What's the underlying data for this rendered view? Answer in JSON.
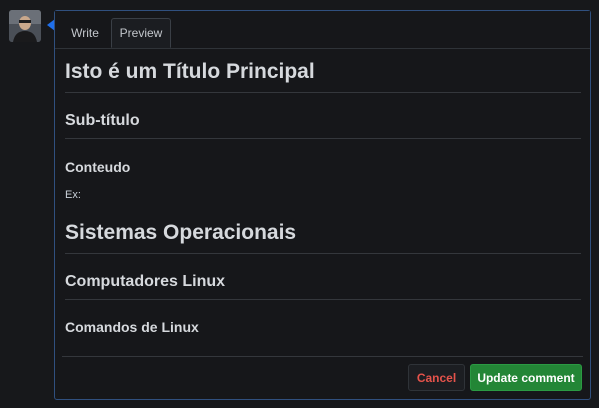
{
  "comment_editor": {
    "tabs": [
      {
        "label": "Write",
        "active": false
      },
      {
        "label": "Preview",
        "active": true
      }
    ],
    "preview": {
      "title": "Isto é um Título Principal",
      "subtitle": "Sub-título",
      "section1": "Conteudo",
      "example": "Ex:",
      "section2": "Sistemas Operacionais",
      "section3": "Computadores Linux",
      "section4": "Comandos de Linux"
    },
    "actions": {
      "cancel_label": "Cancel",
      "update_label": "Update comment"
    }
  },
  "colors": {
    "accent_blue": "#1f6feb",
    "update_green": "#238636",
    "cancel_red": "#e5534b",
    "background": "#17181b"
  }
}
